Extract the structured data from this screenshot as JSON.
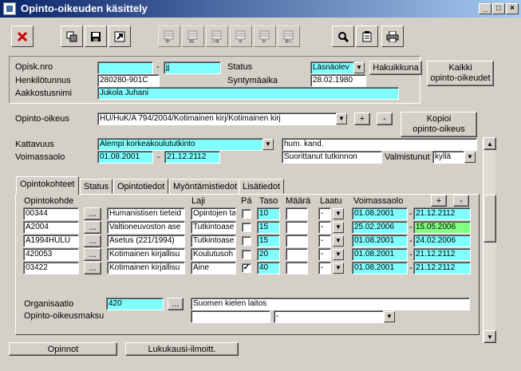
{
  "window": {
    "title": "Opinto-oikeuden käsittely"
  },
  "toolbar": {
    "icons": [
      "close-icon",
      "copy-icon",
      "save-icon",
      "export-icon",
      "new-row-icon",
      "delete-row-icon",
      "first-icon",
      "prev-icon",
      "next-icon",
      "last-icon",
      "search-icon",
      "clipboard-icon",
      "print-icon"
    ]
  },
  "header": {
    "opisk_nro_label": "Opisk.nro",
    "opisk_nro_value": "",
    "opisk_nro_dash": "-",
    "opisk_nro_suffix": "jj",
    "henkilotunnus_label": "Henkilötunnus",
    "henkilotunnus_value": "280280-901C",
    "aakkostusnimi_label": "Aakkostusnimi",
    "aakkostusnimi_value": "Jukola Juhani",
    "status_label": "Status",
    "status_value": "Läsnäolev",
    "syntymaaika_label": "Syntymäaika",
    "syntymaaika_value": "28.02.1980",
    "hakuikkuna_button": "Hakuikkuna",
    "kaikki_button_line1": "Kaikki",
    "kaikki_button_line2": "opinto-oikeudet"
  },
  "oikeus": {
    "opinto_oikeus_label": "Opinto-oikeus",
    "opinto_oikeus_value": "HU/HuK/A 794/2004/Kotimainen kirj/Kotimainen kirj",
    "plus": "+",
    "minus": "-",
    "kopioi_line1": "Kopioi",
    "kopioi_line2": "opinto-oikeus",
    "kattavuus_label": "Kattavuus",
    "kattavuus_value": "Alempi korkeakoulututkinto",
    "kattavuus_extra": "hum. kand.",
    "voimassaolo_label": "Voimassaolo",
    "voimassaolo_start": "01.08.2001",
    "voimassaolo_dash": "-",
    "voimassaolo_end": "21.12.2112",
    "tutkinto_status": "Suorittanut tutkinnon",
    "valmistunut_label": "Valmistunut",
    "valmistunut_value": "kyllä"
  },
  "tabs": [
    "Opintokohteet",
    "Status",
    "Opintotiedot",
    "Myöntämistiedot",
    "Lisätiedot"
  ],
  "table": {
    "headers": {
      "opintokohde": "Opintokohde",
      "laji": "Laji",
      "pa": "Pä",
      "taso": "Taso",
      "maara": "Määrä",
      "laatu": "Laatu",
      "voimassaolo": "Voimassaolo",
      "plus": "+",
      "minus": "-"
    },
    "rows": [
      {
        "code": "00344",
        "name": "Humanistisen tieteid",
        "laji": "Opintojen ta",
        "checked": false,
        "taso": "10",
        "maara": "",
        "laatu": "-",
        "start": "01.08.2001",
        "dash": "-",
        "end": "21.12.2112",
        "end_green": false
      },
      {
        "code": "A2004",
        "name": "Valtioneuvoston ase",
        "laji": "Tutkintoase",
        "checked": false,
        "taso": "15",
        "maara": "",
        "laatu": "-",
        "start": "25.02.2006",
        "dash": "-",
        "end": "15.05.2006",
        "end_green": true
      },
      {
        "code": "A1994HULU",
        "name": "Asetus (221/1994)",
        "laji": "Tutkintoase",
        "checked": false,
        "taso": "15",
        "maara": "",
        "laatu": "-",
        "start": "01.08.2001",
        "dash": "-",
        "end": "24.02.2006",
        "end_green": false
      },
      {
        "code": "420053",
        "name": "Kotimainen kirjallisu",
        "laji": "Koulutusoh",
        "checked": false,
        "taso": "20",
        "maara": "",
        "laatu": "-",
        "start": "01.08.2001",
        "dash": "-",
        "end": "21.12.2112",
        "end_green": false
      },
      {
        "code": "03422",
        "name": "Kotimainen kirjallisu",
        "laji": "Aine",
        "checked": true,
        "taso": "40",
        "maara": "",
        "laatu": "-",
        "start": "01.08.2001",
        "dash": "-",
        "end": "21.12.2112",
        "end_green": false
      }
    ],
    "ellipsis": "..."
  },
  "org": {
    "organisaatio_label": "Organisaatio",
    "organisaatio_code": "420",
    "organisaatio_name": "Suomen kielen laitos",
    "maksu_label": "Opinto-oikeusmaksu",
    "maksu_value": "",
    "maksu_select": "-"
  },
  "bottom": {
    "opinnot_button": "Opinnot",
    "lukukausi_button": "Lukukausi-ilmoitt."
  },
  "colors": {
    "cyan": "#80ffff",
    "green": "#80ff80",
    "titlebar": "#0a246a"
  }
}
